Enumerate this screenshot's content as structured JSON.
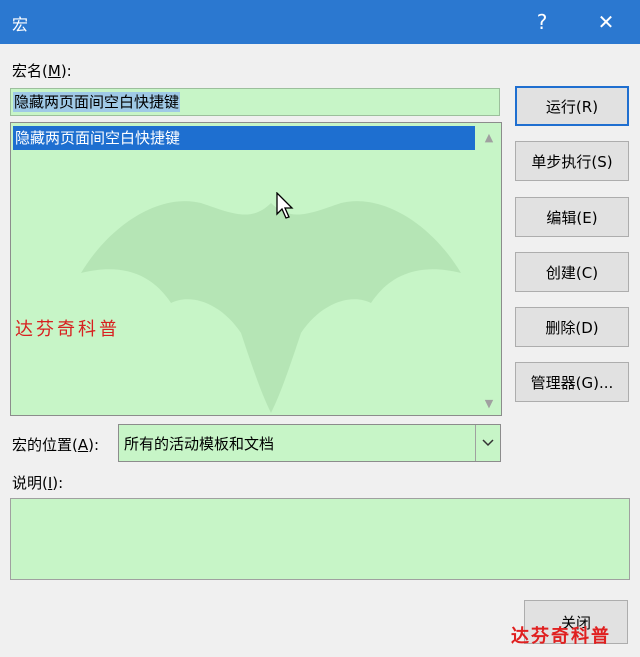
{
  "window": {
    "title": "宏",
    "help_glyph": "?",
    "close_glyph": "✕"
  },
  "macro_name": {
    "label_prefix": "宏名(",
    "label_key": "M",
    "label_suffix": "):",
    "value": "隐藏两页面间空白快捷键"
  },
  "macro_list": {
    "items": [
      "隐藏两页面间空白快捷键"
    ],
    "selected_index": 0
  },
  "buttons": {
    "run": "运行(R)",
    "step": "单步执行(S)",
    "edit": "编辑(E)",
    "create": "创建(C)",
    "delete": "删除(D)",
    "organizer": "管理器(G)...",
    "close": "关闭"
  },
  "location": {
    "label_prefix": "宏的位置(",
    "label_key": "A",
    "label_suffix": "):",
    "value": "所有的活动模板和文档"
  },
  "description": {
    "label_prefix": "说明(",
    "label_key": "I",
    "label_suffix": "):",
    "value": ""
  },
  "watermark": {
    "text": "达芬奇科普"
  },
  "colors": {
    "titlebar": "#2b78d0",
    "field_bg": "#c7f5c7",
    "selection": "#1e6fd0",
    "default_border": "#1f6fd0",
    "watermark": "#d82020"
  }
}
